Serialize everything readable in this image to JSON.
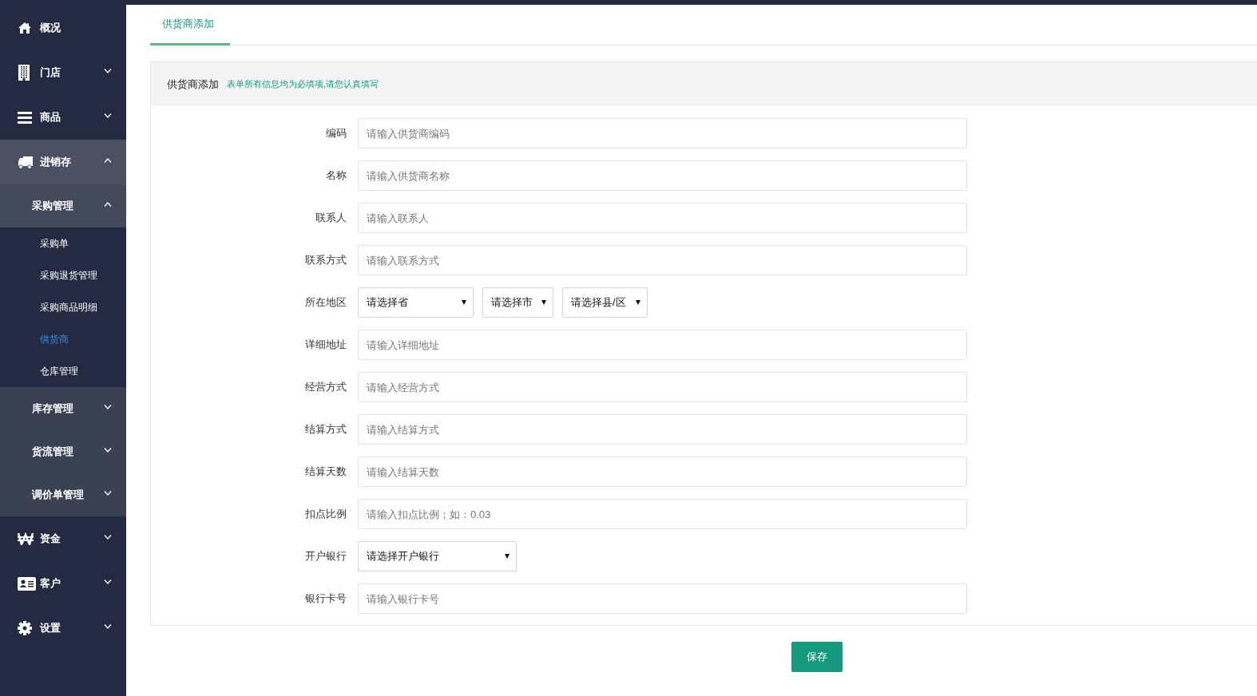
{
  "sidebar": {
    "items": [
      {
        "label": "概况"
      },
      {
        "label": "门店",
        "expanded": false
      },
      {
        "label": "商品",
        "expanded": false
      },
      {
        "label": "进销存",
        "expanded": true,
        "children": [
          {
            "label": "采购管理",
            "expanded": true,
            "children": [
              {
                "label": "采购单",
                "selected": false
              },
              {
                "label": "采购退货管理",
                "selected": false
              },
              {
                "label": "采购商品明细",
                "selected": false
              },
              {
                "label": "供货商",
                "selected": true
              },
              {
                "label": "仓库管理",
                "selected": false
              }
            ]
          },
          {
            "label": "库存管理",
            "expanded": false
          },
          {
            "label": "货流管理",
            "expanded": false
          },
          {
            "label": "调价单管理",
            "expanded": false
          }
        ]
      },
      {
        "label": "资金",
        "expanded": false
      },
      {
        "label": "客户",
        "expanded": false
      },
      {
        "label": "设置",
        "expanded": false
      }
    ]
  },
  "tabs": [
    {
      "label": "供货商添加",
      "selected": true
    }
  ],
  "panel": {
    "title": "供货商添加",
    "note": "表单所有信息均为必填项,请您认真填写"
  },
  "form": [
    {
      "kind": "text",
      "label": "编码",
      "placeholder": "请输入供货商编码"
    },
    {
      "kind": "text",
      "label": "名称",
      "placeholder": "请输入供货商名称"
    },
    {
      "kind": "text",
      "label": "联系人",
      "placeholder": "请输入联系人"
    },
    {
      "kind": "text",
      "label": "联系方式",
      "placeholder": "请输入联系方式"
    },
    {
      "kind": "region",
      "label": "所在地区",
      "selects": [
        {
          "value": "请选择省"
        },
        {
          "value": "请选择市"
        },
        {
          "value": "请选择县/区"
        }
      ]
    },
    {
      "kind": "text",
      "label": "详细地址",
      "placeholder": "请输入详细地址"
    },
    {
      "kind": "text",
      "label": "经营方式",
      "placeholder": "请输入经营方式"
    },
    {
      "kind": "text",
      "label": "结算方式",
      "placeholder": "请输入结算方式"
    },
    {
      "kind": "text",
      "label": "结算天数",
      "placeholder": "请输入结算天数"
    },
    {
      "kind": "text",
      "label": "扣点比例",
      "placeholder": "请输入扣点比例；如：0.03"
    },
    {
      "kind": "select",
      "label": "开户银行",
      "value": "请选择开户银行"
    },
    {
      "kind": "text",
      "label": "银行卡号",
      "placeholder": "请输入银行卡号"
    }
  ],
  "buttons": [
    {
      "label": "保存"
    }
  ]
}
